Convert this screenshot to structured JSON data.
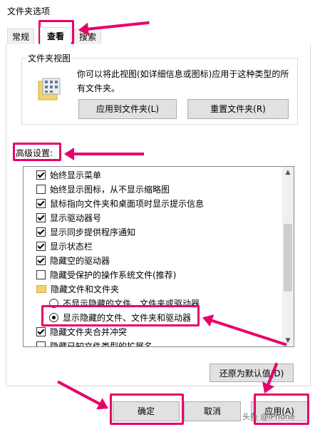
{
  "window": {
    "title": "文件夹选项"
  },
  "tabs": [
    {
      "label": "常规"
    },
    {
      "label": "查看"
    },
    {
      "label": "搜索"
    }
  ],
  "folder_views": {
    "group_title": "文件夹视图",
    "description": "你可以将此视图(如详细信息或图标)应用于这种类型的所有文件夹。",
    "apply_button": "应用到文件夹(L)",
    "reset_button": "重置文件夹(R)"
  },
  "advanced": {
    "label": "高级设置:",
    "items": [
      {
        "type": "checkbox",
        "checked": true,
        "indent": 0,
        "label": "始终显示菜单"
      },
      {
        "type": "checkbox",
        "checked": false,
        "indent": 0,
        "label": "始终显示图标，从不显示缩略图"
      },
      {
        "type": "checkbox",
        "checked": true,
        "indent": 0,
        "label": "鼠标指向文件夹和桌面项时显示提示信息"
      },
      {
        "type": "checkbox",
        "checked": true,
        "indent": 0,
        "label": "显示驱动器号"
      },
      {
        "type": "checkbox",
        "checked": true,
        "indent": 0,
        "label": "显示同步提供程序通知"
      },
      {
        "type": "checkbox",
        "checked": true,
        "indent": 0,
        "label": "显示状态栏"
      },
      {
        "type": "checkbox",
        "checked": true,
        "indent": 0,
        "label": "隐藏空的驱动器"
      },
      {
        "type": "checkbox",
        "checked": false,
        "indent": 0,
        "label": "隐藏受保护的操作系统文件(推荐)"
      },
      {
        "type": "folder",
        "checked": false,
        "indent": 0,
        "label": "隐藏文件和文件夹"
      },
      {
        "type": "radio",
        "checked": false,
        "indent": 1,
        "label": "不显示隐藏的文件、文件夹或驱动器"
      },
      {
        "type": "radio",
        "checked": true,
        "indent": 1,
        "label": "显示隐藏的文件、文件夹和驱动器"
      },
      {
        "type": "checkbox",
        "checked": true,
        "indent": 0,
        "label": "隐藏文件夹合并冲突"
      },
      {
        "type": "checkbox",
        "checked": false,
        "indent": 0,
        "label": "隐藏已知文件类型的扩展名"
      }
    ],
    "restore_button": "还原为默认值(D)"
  },
  "footer": {
    "ok_button": "确定",
    "cancel_button": "取消",
    "apply_button": "应用(A)"
  },
  "watermark": {
    "text": "头条 @iPhone"
  },
  "colors": {
    "annotation": "#e8006a",
    "scroll_thumb": "#cdcdcd",
    "folder": "#f3d16b"
  }
}
